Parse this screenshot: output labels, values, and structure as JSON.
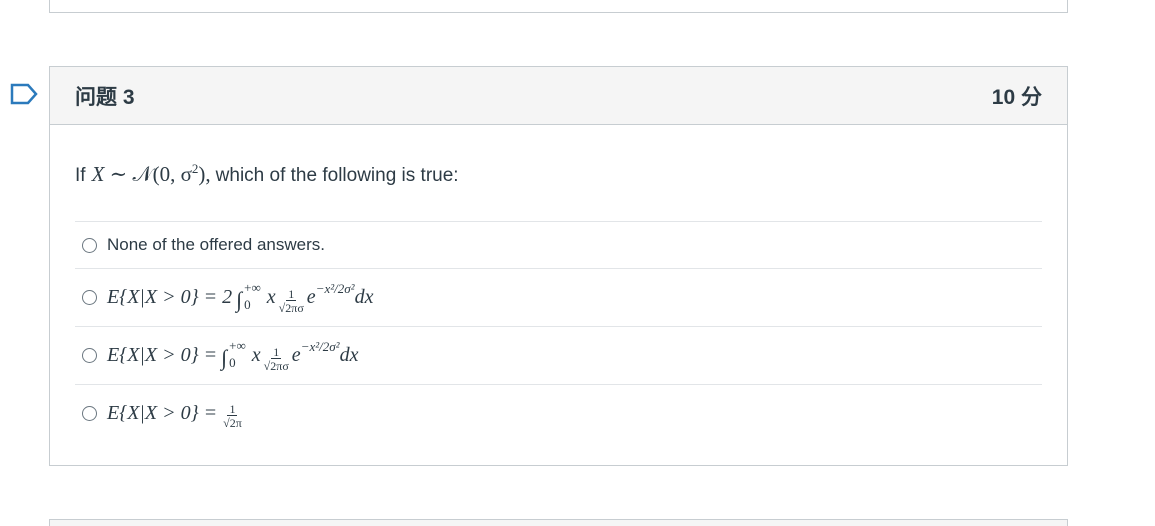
{
  "question": {
    "title": "问题 3",
    "points": "10 分",
    "text_prefix": "If",
    "text_math_var": "X",
    "text_math_rest": "∼ 𝒩(0, σ",
    "text_math_sq": "2",
    "text_math_close": "),",
    "text_suffix": "which of the following is true:"
  },
  "answers": [
    {
      "label": "None of the offered answers."
    },
    {
      "lhs": "E{X|X > 0} = 2",
      "int_hi": "+∞",
      "int_lo": "0",
      "x": "x",
      "frac_num": "1",
      "frac_den": "√2πσ",
      "e": "e",
      "exp": "−x²/2σ²",
      "dx": "dx"
    },
    {
      "lhs": "E{X|X > 0} =",
      "int_hi": "+∞",
      "int_lo": "0",
      "x": "x",
      "frac_num": "1",
      "frac_den": "√2πσ",
      "e": "e",
      "exp": "−x²/2σ²",
      "dx": "dx"
    },
    {
      "lhs": "E{X|X > 0} =",
      "frac_num": "1",
      "frac_den": "√2π"
    }
  ],
  "icons": {
    "flag": "bookmark-flag-icon",
    "radio": "radio-unselected-icon"
  },
  "colors": {
    "flag_blue": "#2b7abc",
    "header_bg": "#f5f5f5",
    "border": "#c7cdd1",
    "text": "#2d3b45"
  }
}
